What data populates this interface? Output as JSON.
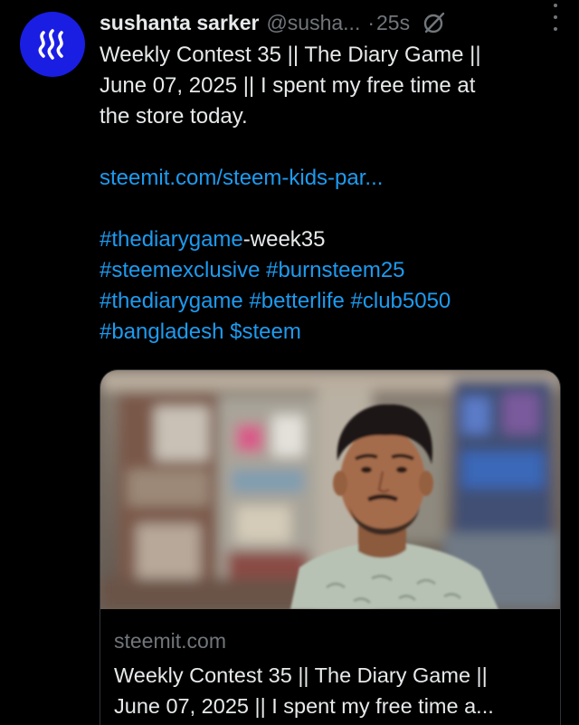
{
  "tweet": {
    "display_name": "sushanta sarker",
    "handle": "@susha...",
    "separator": "·",
    "time": "25s",
    "avatar_icon": "steem-logo-icon",
    "avatar_color": "#1a1ee3",
    "text": {
      "line1": "Weekly Contest 35 || The Diary Game ||",
      "line2": "June 07, 2025 || I spent my free time at",
      "line3": "the store today.",
      "link": "steemit.com/steem-kids-par...",
      "hashtags": {
        "h1": "#thediarygame",
        "h1_suffix": "-week35",
        "h2": "#steemexclusive",
        "h3": "#burnsteem25",
        "h4": "#thediarygame",
        "h5": "#betterlife",
        "h6": "#club5050",
        "h7": "#bangladesh",
        "h8": "$steem"
      }
    },
    "card": {
      "domain": "steemit.com",
      "title_line1": "Weekly Contest 35 || The Diary Game ||",
      "title_line2": "June 07, 2025 || I spent my free time a..."
    }
  },
  "colors": {
    "background": "#000000",
    "text": "#e7e9ea",
    "secondary": "#71767b",
    "link": "#1d9bf0"
  }
}
